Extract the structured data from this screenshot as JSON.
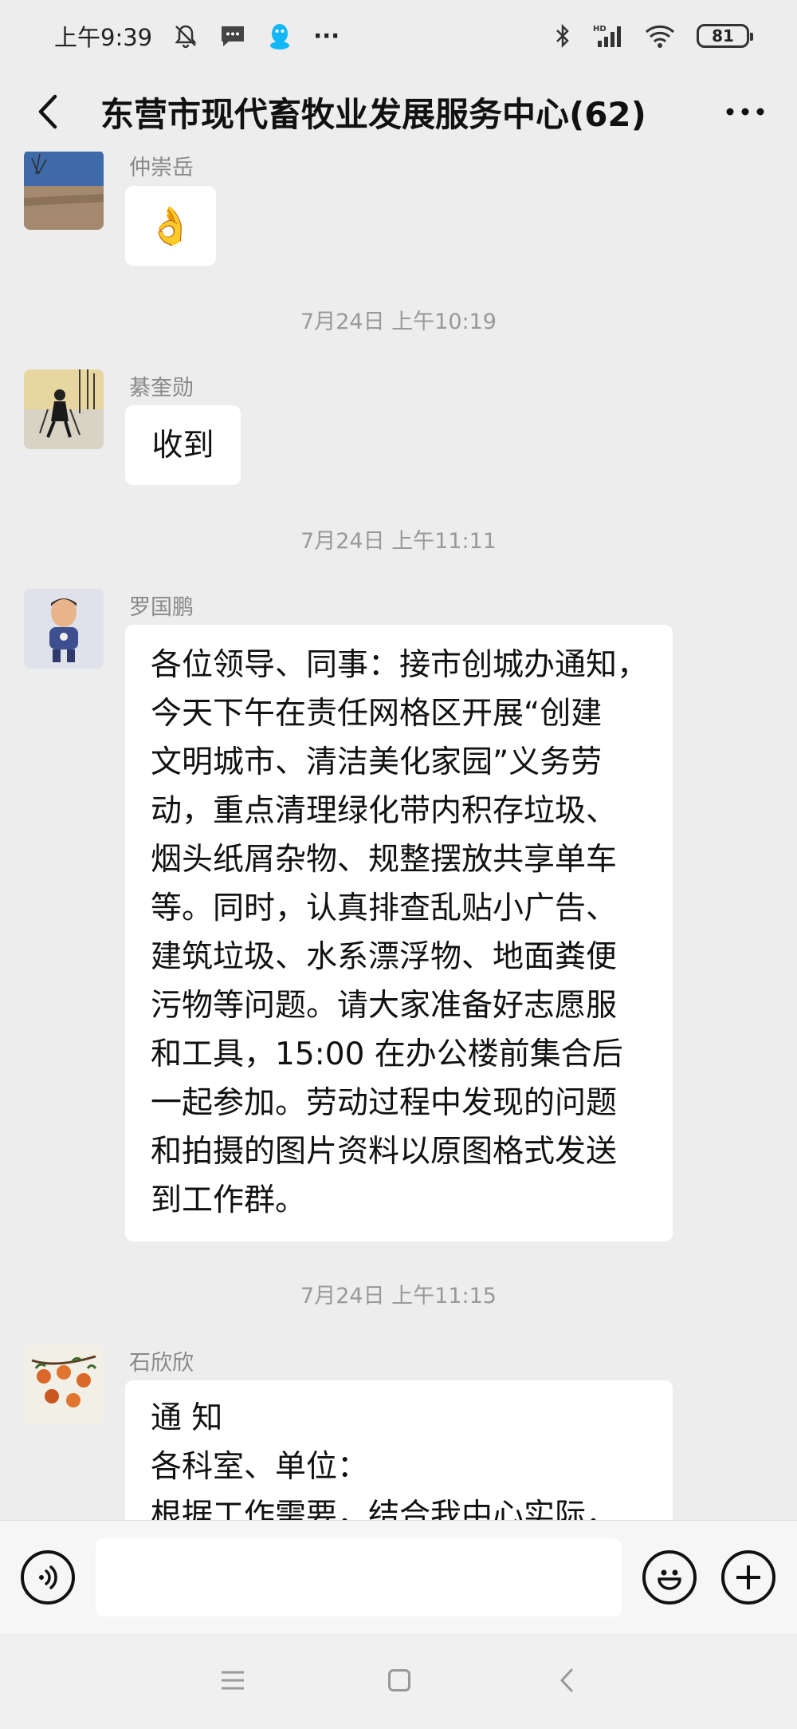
{
  "status_bar": {
    "time": "上午9:39",
    "more_dots": "···",
    "battery": "81",
    "signal_label": "HD"
  },
  "header": {
    "title": "东营市现代畜牧业发展服务中心(62)"
  },
  "messages": [
    {
      "sender": "仲崇岳",
      "content": "👌"
    },
    {
      "timestamp": "7月24日 上午10:19"
    },
    {
      "sender": "綦奎勋",
      "content": "收到"
    },
    {
      "timestamp": "7月24日 上午11:11"
    },
    {
      "sender": "罗国鹏",
      "lines": [
        "各位领导、同事：接市创城办通知，",
        "今天下午在责任网格区开展“创建",
        "文明城市、清洁美化家园”义务劳",
        "动，重点清理绿化带内积存垃圾、",
        "烟头纸屑杂物、规整摆放共享单车",
        "等。同时，认真排查乱贴小广告、",
        "建筑垃圾、水系漂浮物、地面粪便",
        "污物等问题。请大家准备好志愿服",
        "和工具，15:00 在办公楼前集合后",
        "一起参加。劳动过程中发现的问题",
        "和拍摄的图片资料以原图格式发送",
        "到工作群。"
      ]
    },
    {
      "timestamp": "7月24日 上午11:15"
    },
    {
      "sender": "石欣欣",
      "lines": [
        "通 知",
        "各科室、单位：",
        "根据工作需要，结合我中心实际，"
      ]
    }
  ],
  "input": {
    "placeholder": ""
  },
  "icons": {
    "back": "chevron-left-icon",
    "more": "more-dots-icon",
    "voice": "voice-icon",
    "emoji": "emoji-icon",
    "plus": "plus-icon",
    "nav_menu": "menu-icon",
    "nav_home": "home-square-icon",
    "nav_back": "nav-back-icon"
  }
}
